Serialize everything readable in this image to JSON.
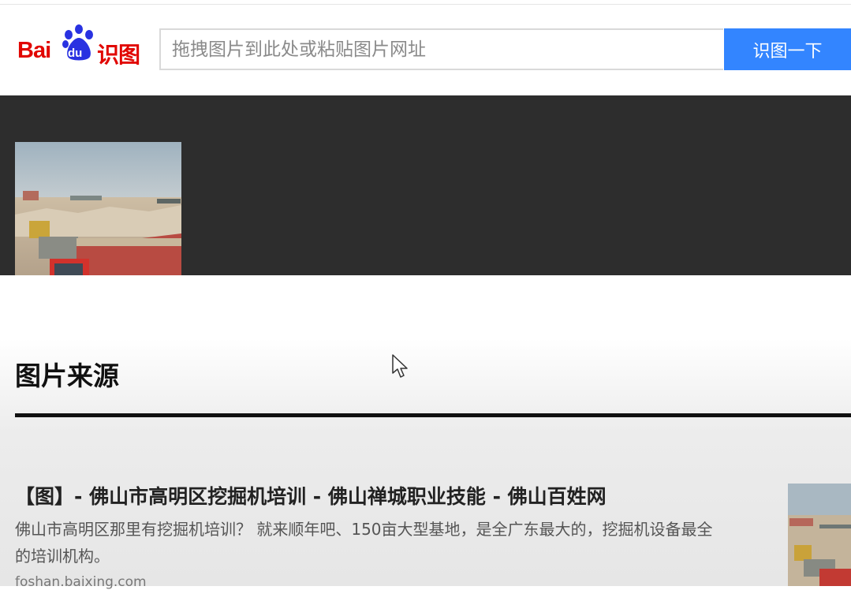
{
  "header": {
    "logo": {
      "part1": "Bai",
      "part2": "du",
      "part3": "识图",
      "icon": "baidu-paw-icon",
      "brand_color": "#e10601"
    },
    "search": {
      "placeholder": "拖拽图片到此处或粘贴图片网址",
      "value": ""
    },
    "search_button": {
      "label": "识图一下",
      "color": "#3385ff"
    }
  },
  "query_image": {
    "icon": "construction-site-photo"
  },
  "section": {
    "title": "图片来源"
  },
  "result": {
    "title": "【图】- 佛山市高明区挖掘机培训 - 佛山禅城职业技能 - 佛山百姓网",
    "description": "佛山市高明区那里有挖掘机培训？ 就来顺年吧、150亩大型基地，是全广东最大的，挖掘机设备最全的培训机构。",
    "domain": "foshan.baixing.com"
  },
  "colors": {
    "dark_band": "#2d2d2d",
    "page_bg": "#ffffff"
  }
}
